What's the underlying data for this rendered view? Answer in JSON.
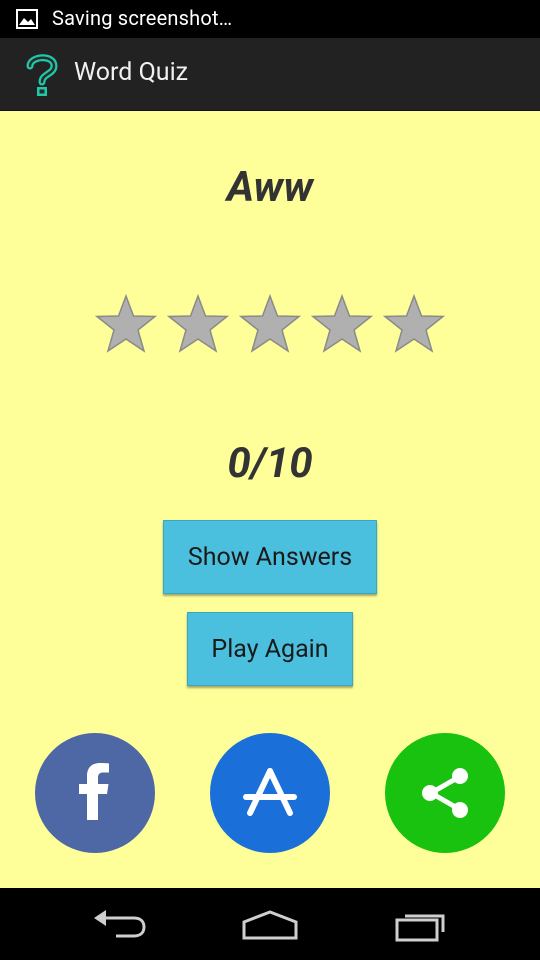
{
  "status_bar": {
    "notification_icon": "image-icon",
    "text": "Saving screenshot…"
  },
  "action_bar": {
    "app_icon": "question-mark-icon",
    "title": "Word Quiz"
  },
  "result": {
    "word": "Aww",
    "rating": 0,
    "rating_max": 5,
    "score": "0/10"
  },
  "buttons": {
    "show_answers": "Show Answers",
    "play_again": "Play Again"
  },
  "share_buttons": [
    {
      "icon": "facebook-icon",
      "color": "#4d68a5"
    },
    {
      "icon": "app-store-icon",
      "color": "#1a6fd9"
    },
    {
      "icon": "share-icon",
      "color": "#19c20f"
    }
  ],
  "nav_bar": {
    "icons": [
      "back-icon",
      "home-icon",
      "recent-apps-icon"
    ]
  },
  "colors": {
    "background": "#ffff99",
    "button": "#4ac0de",
    "star_empty": "#b0b0b0"
  }
}
